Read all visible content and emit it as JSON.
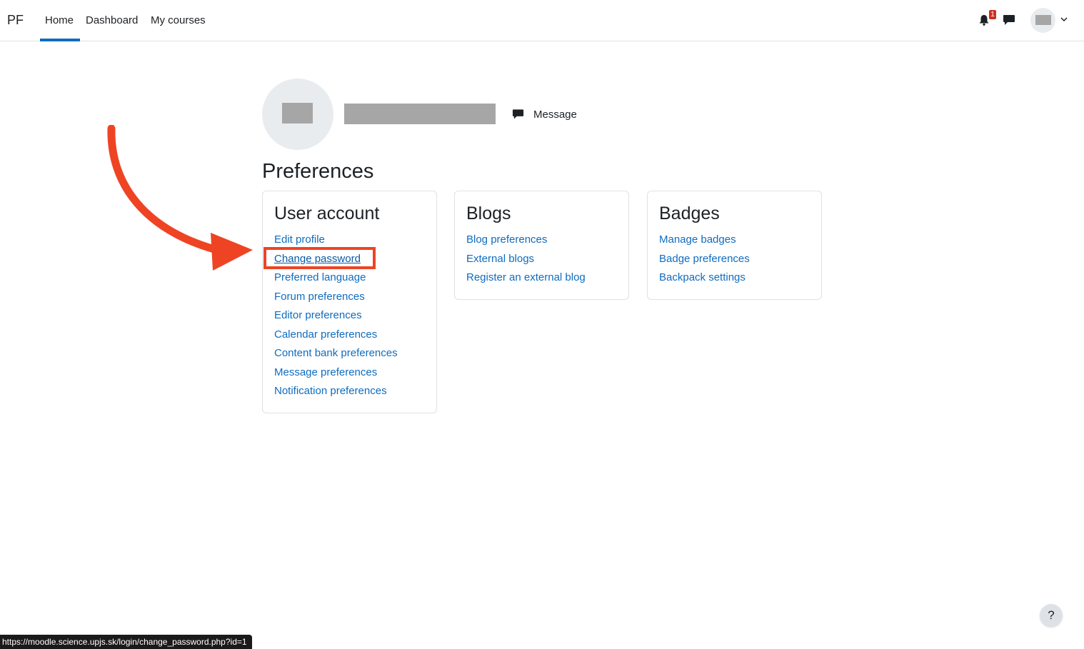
{
  "navbar": {
    "brand": "PF",
    "links": [
      "Home",
      "Dashboard",
      "My courses"
    ],
    "active_link": "Home",
    "notification_count": "1",
    "icons": [
      "bell-icon",
      "chat-icon",
      "user-menu-caret-icon"
    ]
  },
  "profile": {
    "message_label": "Message"
  },
  "page": {
    "title": "Preferences"
  },
  "cards": {
    "user_account": {
      "title": "User account",
      "items": [
        "Edit profile",
        "Change password",
        "Preferred language",
        "Forum preferences",
        "Editor preferences",
        "Calendar preferences",
        "Content bank preferences",
        "Message preferences",
        "Notification preferences"
      ]
    },
    "blogs": {
      "title": "Blogs",
      "items": [
        "Blog preferences",
        "External blogs",
        "Register an external blog"
      ]
    },
    "badges": {
      "title": "Badges",
      "items": [
        "Manage badges",
        "Badge preferences",
        "Backpack settings"
      ]
    }
  },
  "status_bar": {
    "url": "https://moodle.science.upjs.sk/login/change_password.php?id=1"
  },
  "help": {
    "label": "?"
  },
  "colors": {
    "link": "#0f6cbf",
    "annotation": "#ee4424",
    "badge": "#ca3120"
  }
}
